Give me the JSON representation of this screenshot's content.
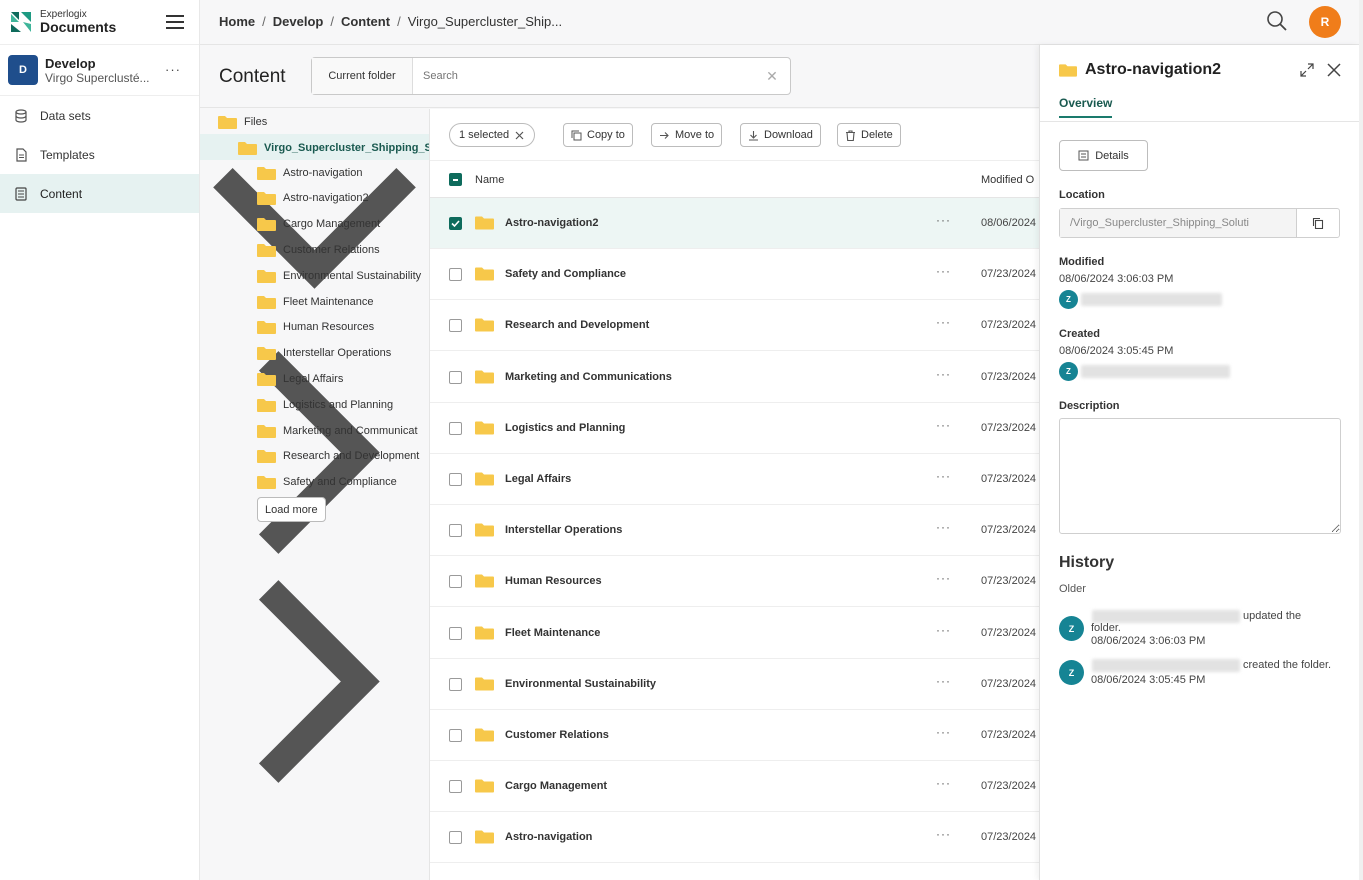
{
  "brand": {
    "top": "Experlogix",
    "bottom": "Documents"
  },
  "workspace": {
    "initial": "D",
    "name": "Develop",
    "sub": "Virgo Superclusté...",
    "more": "···"
  },
  "nav": [
    {
      "label": "Data sets",
      "icon": "database-icon"
    },
    {
      "label": "Templates",
      "icon": "document-icon"
    },
    {
      "label": "Content",
      "icon": "content-icon",
      "active": true
    }
  ],
  "breadcrumb": [
    "Home",
    "Develop",
    "Content",
    "Virgo_Supercluster_Ship..."
  ],
  "user_initial": "R",
  "content_title": "Content",
  "search": {
    "scope": "Current folder",
    "placeholder": "Search"
  },
  "tree": {
    "root": "Files",
    "folder": "Virgo_Supercluster_Shipping_S",
    "children": [
      "Astro-navigation",
      "Astro-navigation2",
      "Cargo Management",
      "Customer Relations",
      "Environmental Sustainability",
      "Fleet Maintenance",
      "Human Resources",
      "Interstellar Operations",
      "Legal Affairs",
      "Logistics and Planning",
      "Marketing and Communicat",
      "Research and Development",
      "Safety and Compliance"
    ],
    "load_more": "Load more"
  },
  "toolbar": {
    "selected": "1 selected",
    "copy": "Copy to",
    "move": "Move to",
    "download": "Download",
    "delete": "Delete"
  },
  "list": {
    "col_name": "Name",
    "col_modified": "Modified O",
    "rows": [
      {
        "name": "Astro-navigation2",
        "modified": "08/06/2024",
        "selected": true
      },
      {
        "name": "Safety and Compliance",
        "modified": "07/23/2024"
      },
      {
        "name": "Research and Development",
        "modified": "07/23/2024"
      },
      {
        "name": "Marketing and Communications",
        "modified": "07/23/2024"
      },
      {
        "name": "Logistics and Planning",
        "modified": "07/23/2024"
      },
      {
        "name": "Legal Affairs",
        "modified": "07/23/2024"
      },
      {
        "name": "Interstellar Operations",
        "modified": "07/23/2024"
      },
      {
        "name": "Human Resources",
        "modified": "07/23/2024"
      },
      {
        "name": "Fleet Maintenance",
        "modified": "07/23/2024"
      },
      {
        "name": "Environmental Sustainability",
        "modified": "07/23/2024"
      },
      {
        "name": "Customer Relations",
        "modified": "07/23/2024"
      },
      {
        "name": "Cargo Management",
        "modified": "07/23/2024"
      },
      {
        "name": "Astro-navigation",
        "modified": "07/23/2024"
      }
    ]
  },
  "panel": {
    "title": "Astro-navigation2",
    "tab": "Overview",
    "details_btn": "Details",
    "location_label": "Location",
    "location_value": "/Virgo_Supercluster_Shipping_Soluti",
    "modified_label": "Modified",
    "modified_value": "08/06/2024 3:06:03 PM",
    "created_label": "Created",
    "created_value": "08/06/2024 3:05:45 PM",
    "description_label": "Description",
    "history_title": "History",
    "history_older": "Older",
    "avatar_initial": "Z",
    "history": [
      {
        "action": "updated the",
        "action2": "folder.",
        "time": "08/06/2024 3:06:03 PM"
      },
      {
        "action": "created the folder.",
        "time": "08/06/2024 3:05:45 PM"
      }
    ]
  },
  "colors": {
    "accent": "#0e6b5c",
    "avatar_user": "#f07d1a",
    "avatar_z": "#168494",
    "workspace": "#1f4e8c",
    "folder": "#f7c84a"
  }
}
